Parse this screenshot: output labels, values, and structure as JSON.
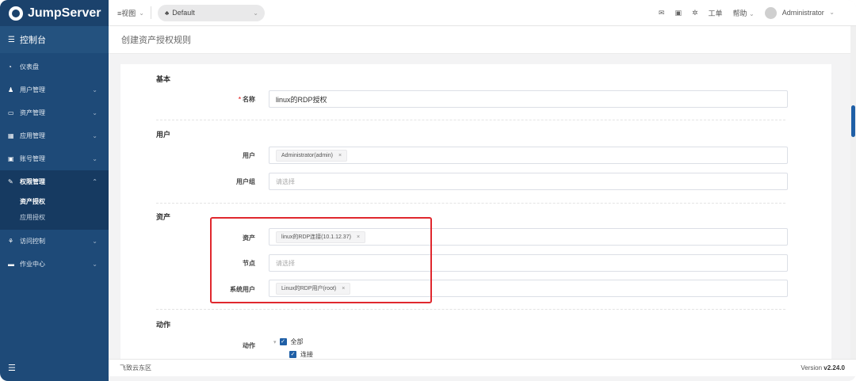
{
  "brand": {
    "name": "JumpServer"
  },
  "sidebar": {
    "console_label": "控制台",
    "items": [
      {
        "label": "仪表盘",
        "icon": "dashboard-icon",
        "has_children": false
      },
      {
        "label": "用户管理",
        "icon": "users-icon",
        "has_children": true
      },
      {
        "label": "资产管理",
        "icon": "inbox-icon",
        "has_children": true
      },
      {
        "label": "应用管理",
        "icon": "grid-icon",
        "has_children": true
      },
      {
        "label": "账号管理",
        "icon": "id-card-icon",
        "has_children": true
      },
      {
        "label": "权限管理",
        "icon": "edit-icon",
        "has_children": true,
        "expanded": true,
        "children": [
          {
            "label": "资产授权",
            "active": true
          },
          {
            "label": "应用授权",
            "active": false
          }
        ]
      },
      {
        "label": "访问控制",
        "icon": "sitemap-icon",
        "has_children": true
      },
      {
        "label": "作业中心",
        "icon": "monitor-icon",
        "has_children": true
      }
    ]
  },
  "topbar": {
    "view_label": "≡视图",
    "org_label": "Default",
    "ticket_label": "工单",
    "help_label": "帮助",
    "user_label": "Administrator"
  },
  "page": {
    "title": "创建资产授权规则"
  },
  "form": {
    "basic": {
      "title": "基本",
      "name_label": "名称",
      "name_value": "linux的RDP授权"
    },
    "user": {
      "title": "用户",
      "users_label": "用户",
      "users_tag": "Administrator(admin)",
      "groups_label": "用户组",
      "groups_placeholder": "请选择"
    },
    "asset": {
      "title": "资产",
      "assets_label": "资产",
      "assets_tag": "linux的RDP连接(10.1.12.37)",
      "nodes_label": "节点",
      "nodes_placeholder": "请选择",
      "system_users_label": "系统用户",
      "system_users_tag": "Linux的RDP用户(root)"
    },
    "action": {
      "title": "动作",
      "actions_label": "动作",
      "all_label": "全部",
      "connect_label": "连接"
    }
  },
  "footer": {
    "region": "飞致云东区",
    "version_prefix": "Version",
    "version": "v2.24.0"
  },
  "colors": {
    "sidebar": "#1e4a78",
    "accent": "#1f5fa6",
    "highlight": "#e0282e"
  }
}
